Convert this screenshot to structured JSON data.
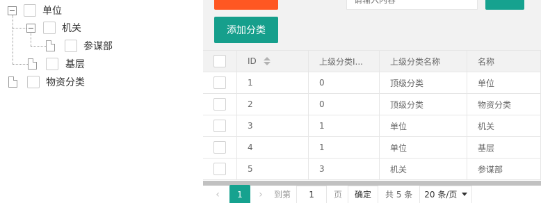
{
  "tree": {
    "nodes": [
      {
        "label": "单位"
      },
      {
        "label": "机关"
      },
      {
        "label": "参谋部"
      },
      {
        "label": "基层"
      },
      {
        "label": "物资分类"
      }
    ]
  },
  "toolbar": {
    "add_label": "添加分类",
    "search_value": "请输入内容"
  },
  "table": {
    "columns": [
      "ID",
      "上级分类I...",
      "上级分类名称",
      "名称"
    ],
    "rows": [
      {
        "id": "1",
        "parent_id": "0",
        "parent_name": "顶级分类",
        "name": "单位"
      },
      {
        "id": "2",
        "parent_id": "0",
        "parent_name": "顶级分类",
        "name": "物资分类"
      },
      {
        "id": "3",
        "parent_id": "1",
        "parent_name": "单位",
        "name": "机关"
      },
      {
        "id": "4",
        "parent_id": "1",
        "parent_name": "单位",
        "name": "基层"
      },
      {
        "id": "5",
        "parent_id": "3",
        "parent_name": "机关",
        "name": "参谋部"
      }
    ]
  },
  "pager": {
    "prev": "‹",
    "current": "1",
    "next": "›",
    "goto_label": "到第",
    "goto_value": "1",
    "page_unit": "页",
    "confirm_label": "确定",
    "total": "共 5 条",
    "page_size": "20 条/页"
  },
  "colors": {
    "accent": "#16a28f",
    "orange": "#ff5722"
  }
}
